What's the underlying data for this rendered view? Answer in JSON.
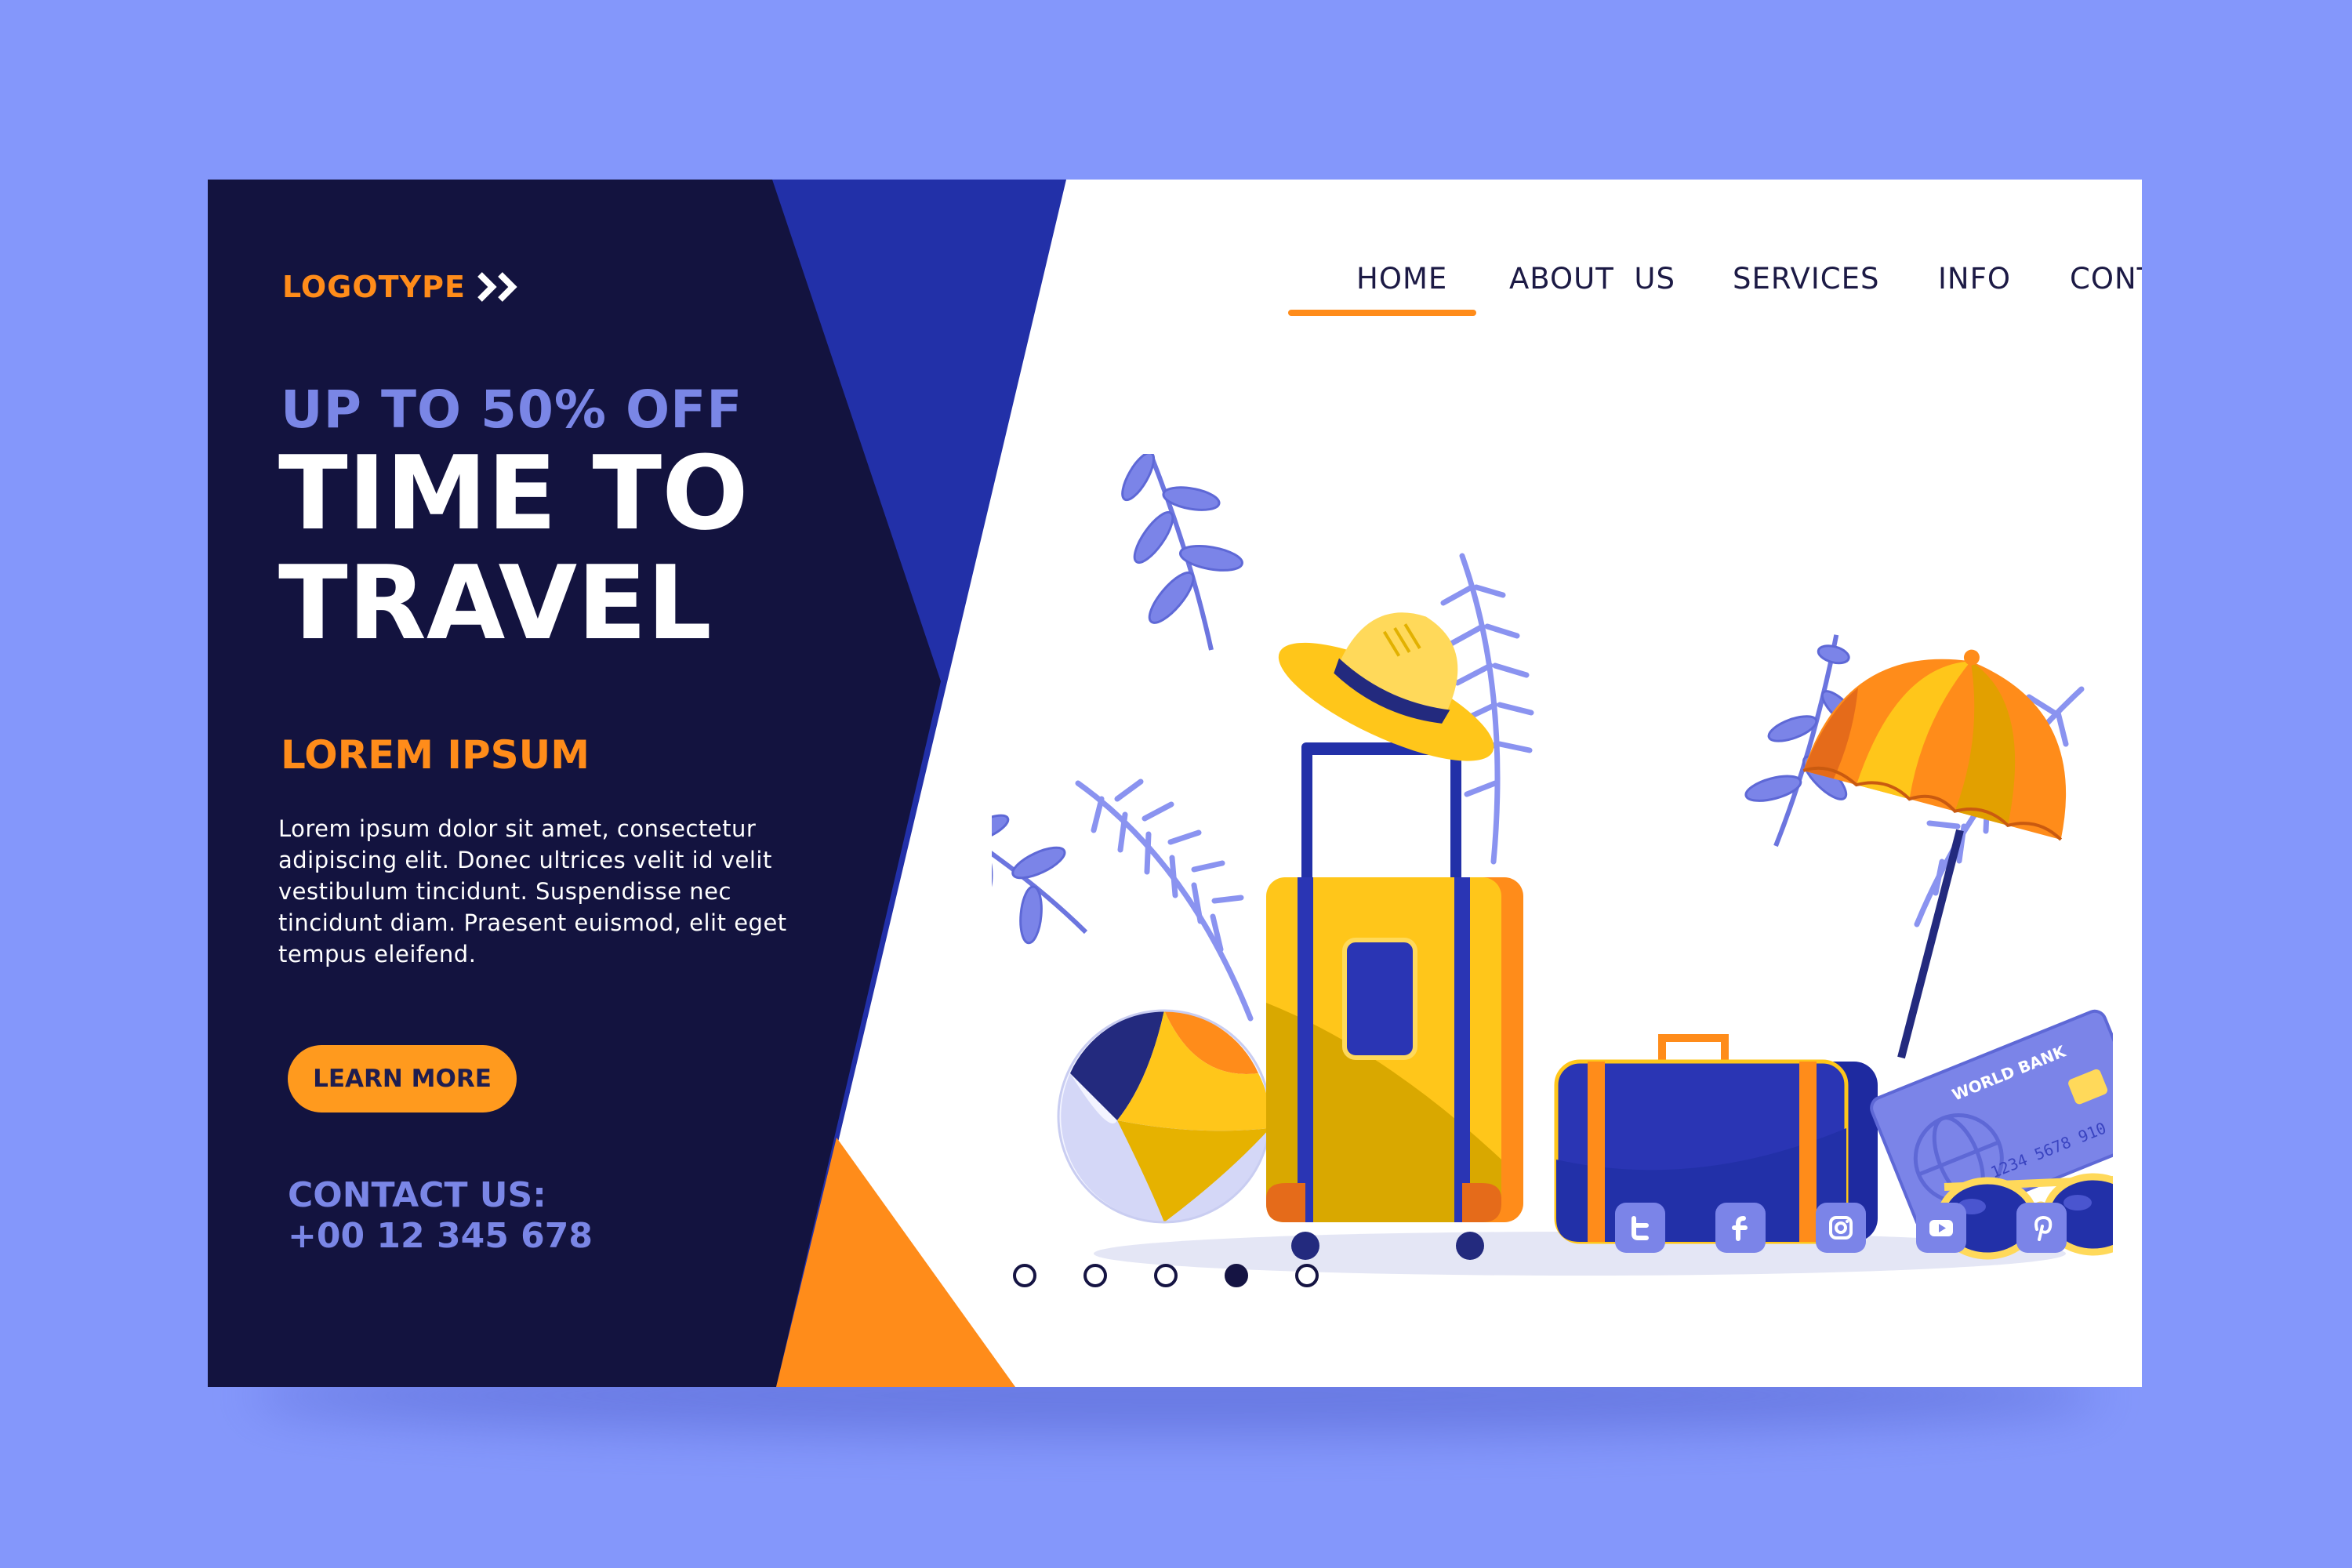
{
  "brand": {
    "logo_text": "LOGOTYPE",
    "colors": {
      "navy": "#13133f",
      "royal_blue": "#2230a8",
      "orange": "#ff8c1a",
      "periwinkle": "#7a86e6",
      "background": "#8497fb"
    }
  },
  "nav": {
    "items": [
      {
        "label": "HOME"
      },
      {
        "label": "ABOUT  US"
      },
      {
        "label": "SERVICES"
      },
      {
        "label": "INFO"
      },
      {
        "label": "CONTACT  US"
      }
    ],
    "active_index": 1
  },
  "hero": {
    "promo": "UP TO 50% OFF",
    "headline_line1": "TIME TO",
    "headline_line2": "TRAVEL",
    "subhead": "LOREM IPSUM",
    "body": "Lorem ipsum dolor sit amet, consectetur adipiscing elit. Donec ultrices velit id velit vestibulum tincidunt. Suspendisse nec tincidunt diam. Praesent euismod, elit eget tempus eleifend.",
    "cta_label": "LEARN MORE"
  },
  "contact": {
    "label": "CONTACT US:",
    "phone": "+00 12 345 678"
  },
  "illustration": {
    "card_bank": "WORLD BANK",
    "card_number": "1234 5678 910"
  },
  "social": {
    "icons": [
      "twitter-icon",
      "facebook-icon",
      "instagram-icon",
      "youtube-icon",
      "pinterest-icon"
    ]
  },
  "carousel": {
    "count": 5,
    "active_index": 3
  }
}
